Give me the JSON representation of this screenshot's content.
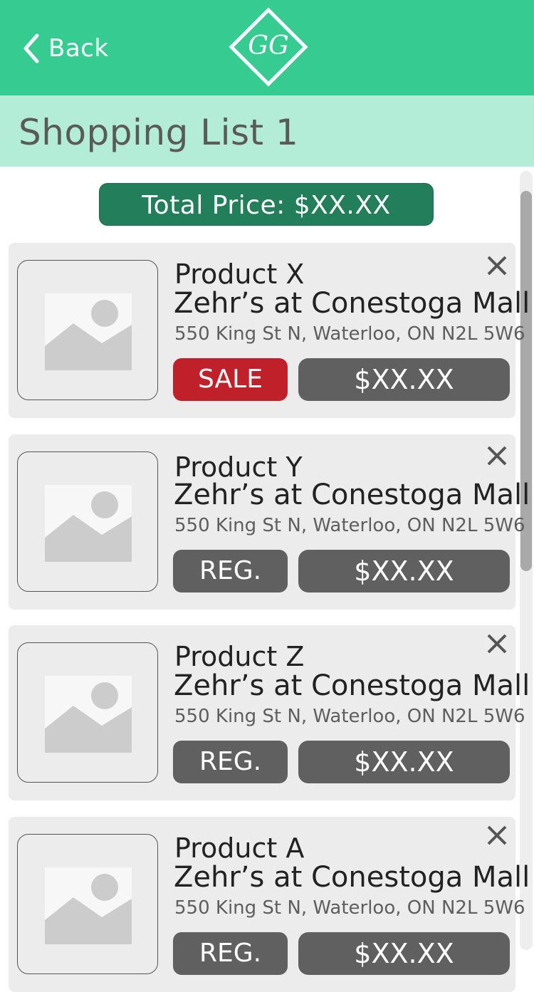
{
  "header": {
    "back_label": "Back",
    "logo_text": "GG",
    "brand_color": "#36cc91"
  },
  "title": "Shopping List 1",
  "total_price_label": "Total Price: $XX.XX",
  "items": [
    {
      "name": "Product X",
      "store": "Zehr’s at Conestoga Mall",
      "address": "550 King St N, Waterloo, ON N2L 5W6",
      "tag": "SALE",
      "price": "$XX.XX"
    },
    {
      "name": "Product Y",
      "store": "Zehr’s at Conestoga Mall",
      "address": "550 King St N, Waterloo, ON N2L 5W6",
      "tag": "REG.",
      "price": "$XX.XX"
    },
    {
      "name": "Product Z",
      "store": "Zehr’s at Conestoga Mall",
      "address": "550 King St N, Waterloo, ON N2L 5W6",
      "tag": "REG.",
      "price": "$XX.XX"
    },
    {
      "name": "Product A",
      "store": "Zehr’s at Conestoga Mall",
      "address": "550 King St N, Waterloo, ON N2L 5W6",
      "tag": "REG.",
      "price": "$XX.XX"
    }
  ],
  "icons": {
    "back": "chevron-left-icon",
    "close": "close-icon",
    "thumbnail": "image-placeholder-icon"
  },
  "colors": {
    "title_bar": "#b3ecd7",
    "total_button": "#227e5b",
    "sale_tag": "#c0202a",
    "regular_tag": "#606060"
  }
}
